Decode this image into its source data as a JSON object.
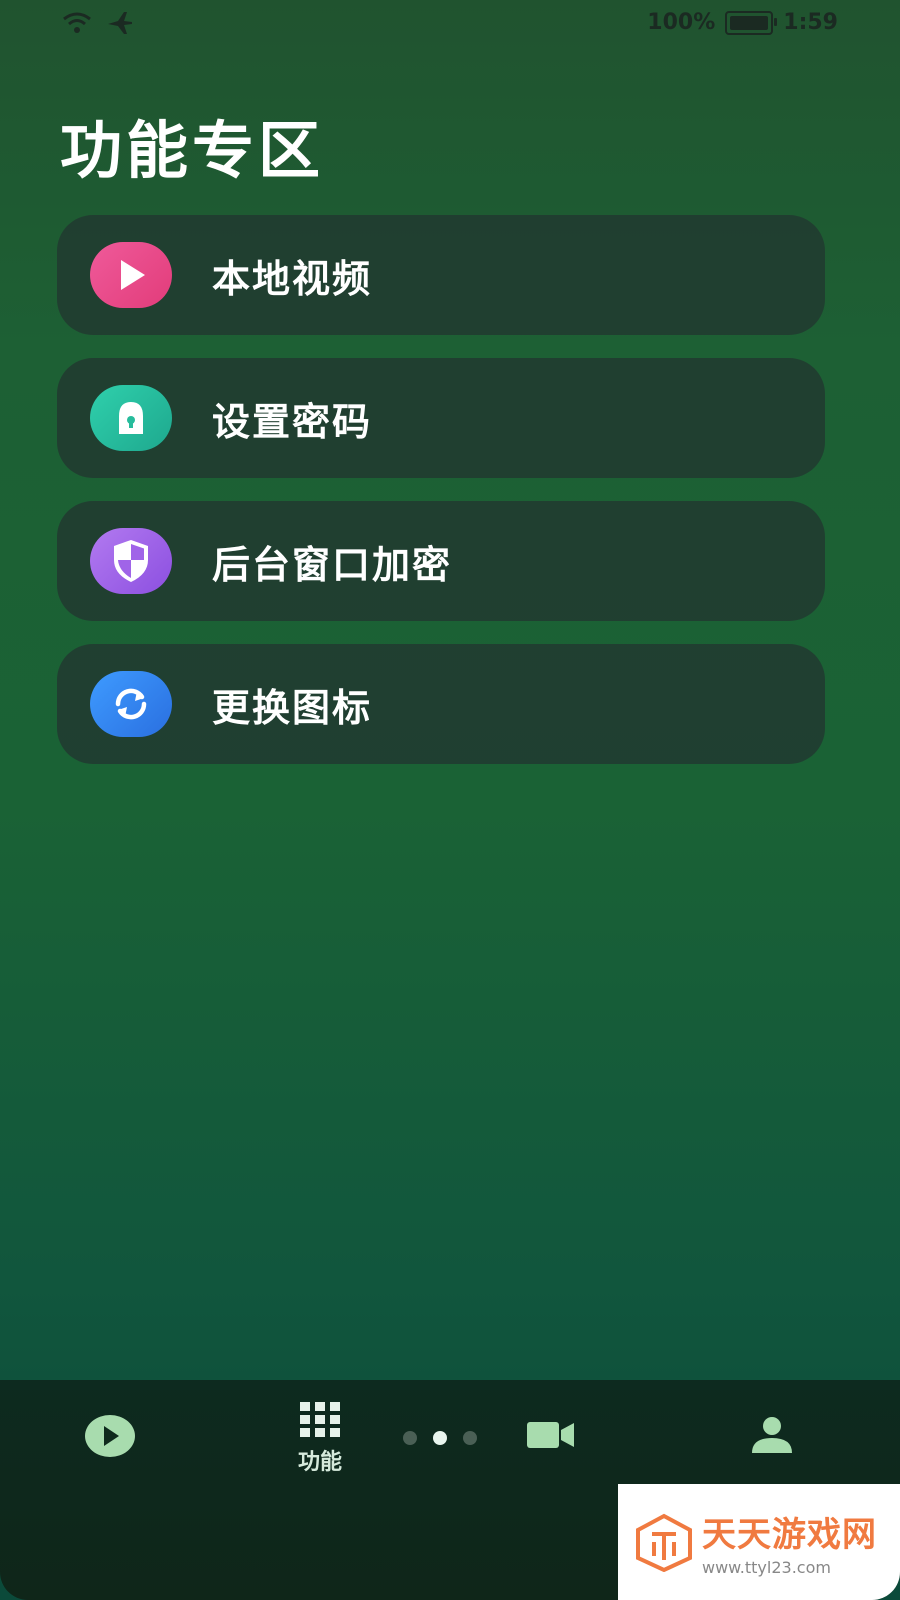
{
  "status_bar": {
    "battery": "100%",
    "time": "1:59"
  },
  "page": {
    "title": "功能专区"
  },
  "menu": {
    "items": [
      {
        "label": "本地视频",
        "icon": "play-icon",
        "color": "#e84a8a"
      },
      {
        "label": "设置密码",
        "icon": "lock-icon",
        "color": "#27bc9c"
      },
      {
        "label": "后台窗口加密",
        "icon": "shield-icon",
        "color": "#a064e8"
      },
      {
        "label": "更换图标",
        "icon": "refresh-icon",
        "color": "#3486f0"
      }
    ]
  },
  "bottom_nav": {
    "active_label": "功能",
    "pager_active_index": 1,
    "pager_count": 3
  },
  "watermark": {
    "title": "天天游戏网",
    "url": "www.ttyl23.com"
  }
}
